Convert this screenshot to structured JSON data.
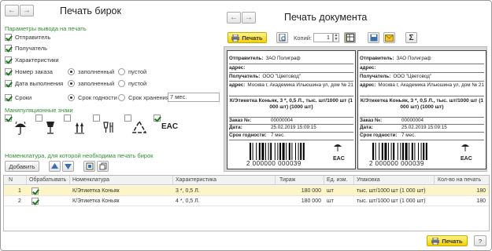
{
  "left": {
    "title": "Печать бирок",
    "section_print": "Параметры вывода на печать",
    "opts": [
      {
        "label": "Отправитель",
        "checked": true
      },
      {
        "label": "Получатель",
        "checked": true
      },
      {
        "label": "Характеристики",
        "checked": true
      },
      {
        "label": "Номер заказа",
        "checked": true
      },
      {
        "label": "Дата выполнения",
        "checked": true
      },
      {
        "label": "Сроки",
        "checked": true
      }
    ],
    "radio_filled": "заполненный",
    "radio_empty": "пустой",
    "radio_shelf": "Срок годности",
    "radio_store": "Срок хранения",
    "storage_value": "7 мес.",
    "section_signs": "Манипуляционные знаки",
    "section_nomen": "Номенклатура, для которой необходима печать бирок",
    "add_label": "Добавить"
  },
  "right": {
    "title": "Печать документа",
    "print_label": "Печать",
    "copies_label": "Копий:",
    "copies_value": "1"
  },
  "tag": {
    "sender_l": "Отправитель:",
    "sender_v": "ЗАО Полиграф",
    "addr_l": "адрес:",
    "recv_l": "Получатель:",
    "recv_v": "ООО \"Цветовод\"",
    "addr2_l": "адрес:",
    "addr2_v": "Москва г, Академика Ильюшина ул, дом № 21",
    "product": "К/Этикетка Коньяк, 3 *, 0,5 Л., тыс. шт/1000 шт (1 000 шт) (1000 шт)",
    "order_l": "Заказ №:",
    "order_v": "00000004",
    "date_l": "Дата:",
    "date_v": "25.02.2019 15:09:15",
    "shelf_l": "Срок годности:",
    "shelf_v": "7 мес.",
    "barcode": "2 000000 000039",
    "eac": "EAC"
  },
  "grid": {
    "cols": [
      "N",
      "Обрабатывать",
      "Номенклатура",
      "Характеристика",
      "Тираж",
      "Ед. изм.",
      "Упаковка",
      "Кол-во на печать"
    ],
    "rows": [
      {
        "n": "1",
        "nom": "К/Этикетка Коньяк",
        "char": "3 *, 0,5 Л.",
        "qty": "180 000",
        "unit": "шт",
        "pack": "тыс. шт/1000 шт (1 000 шт)",
        "print": "180"
      },
      {
        "n": "2",
        "nom": "К/Этикетка Коньяк",
        "char": "4 *, 0,5 Л.",
        "qty": "180 000",
        "unit": "шт",
        "pack": "тыс. шт/1000 шт (1 000 шт)",
        "print": "180"
      }
    ]
  },
  "footer": {
    "print_label": "Печать",
    "help": "?"
  }
}
